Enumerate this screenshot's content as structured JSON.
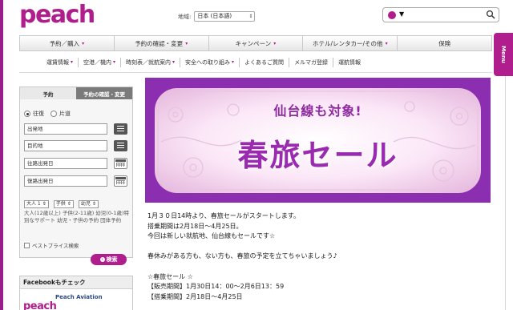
{
  "brand": {
    "logo_text": "peach",
    "accent": "#b01e8e"
  },
  "region": {
    "label": "地域:",
    "selected": "日本 (日本語)"
  },
  "search": {
    "selected": "",
    "icon": "search-icon"
  },
  "main_nav": [
    {
      "label": "予約／購入"
    },
    {
      "label": "予約の確認・変更"
    },
    {
      "label": "キャンペーン"
    },
    {
      "label": "ホテル/レンタカー/その他"
    },
    {
      "label": "保険"
    }
  ],
  "sub_nav": [
    {
      "label": "運賃情報"
    },
    {
      "label": "空港／機内"
    },
    {
      "label": "時刻表／就航案内"
    },
    {
      "label": "安全への取り組み"
    },
    {
      "label": "よくあるご質問"
    },
    {
      "label": "メルマガ登録"
    },
    {
      "label": "運航情報"
    }
  ],
  "menu_tab": {
    "label": "Menu"
  },
  "booking": {
    "tab_book": "予約",
    "tab_manage": "予約の確認・変更",
    "round_trip": "往復",
    "one_way": "片道",
    "origin_placeholder": "出発地",
    "destination_placeholder": "目的地",
    "depart_date_placeholder": "往路出発日",
    "return_date_placeholder": "復路出発日",
    "adults": "大人 1",
    "children": "子供",
    "infants": "幼児",
    "pax_help": "大人(12歳以上) 子供(2-11歳) 幼児(0-1歳)特別なサポート 幼児・子供の予約 団体予約",
    "best_price": "ベストプライス検索",
    "search_button": "検索"
  },
  "facebook": {
    "title": "Facebookもチェック",
    "logo": "peach",
    "name": "Peach Aviation"
  },
  "banner": {
    "subtitle": "仙台線も対象!",
    "title": "春旅セール"
  },
  "article": {
    "lines": [
      "1月３０日14時より、春旅セールがスタートします。",
      "搭乗期間は2月18日～4月25日。",
      "今回は新しい就航地、仙台線もセールです☆",
      "",
      "春休みがある方も、ない方も、春旅の予定を立てちゃいましょう♪",
      "",
      "☆春旅セール ☆",
      "【販売期間】1月30日14：00～2月6日13：59",
      "【搭乗期間】2月18日～4月25日"
    ]
  }
}
